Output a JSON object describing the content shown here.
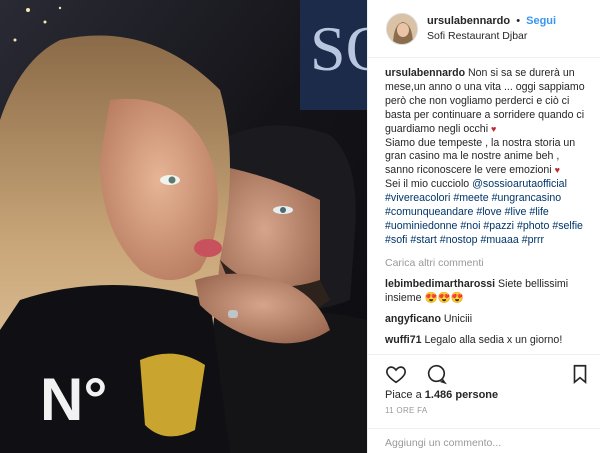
{
  "header": {
    "username": "ursulabennardo",
    "dot": "•",
    "follow_label": "Segui",
    "location": "Sofi Restaurant Djbar"
  },
  "photo": {
    "shirt_text": "N°",
    "sign_text": "SO"
  },
  "caption": {
    "username": "ursulabennardo",
    "p1": "Non si sa se durerà un mese,un anno o una vita ... oggi sappiamo però che non vogliamo perderci e ciò ci basta per continuare a sorridere quando ci guardiamo negli occhi",
    "p2": "Siamo due tempeste , la nostra storia un gran casino ma le nostre anime beh , sanno riconoscere le vere emozioni",
    "p3": "Sei il mio cucciolo",
    "mention": "@sossioarutaofficial",
    "hashtags": [
      "#vivereacolori",
      "#meete",
      "#ungrancasino",
      "#comunqueandare",
      "#love",
      "#live",
      "#life",
      "#uominiedonne",
      "#noi",
      "#pazzi",
      "#photo",
      "#selfie",
      "#sofi",
      "#start",
      "#nostop",
      "#muaaa",
      "#prrr"
    ],
    "heart": "♥"
  },
  "load_more": "Carica altri commenti",
  "comments": [
    {
      "user": "lebimbedimartharossi",
      "text": "Siete bellissimi insieme 😍😍😍"
    },
    {
      "user": "angyficano",
      "text": "Uniciii"
    },
    {
      "user": "wuffi71",
      "text": "Legalo alla sedia x un giorno!"
    },
    {
      "user": "",
      "text": ""
    }
  ],
  "actions": {
    "likes_prefix": "Piace a",
    "likes_count": "1.486 persone",
    "time": "11 ORE FA",
    "add_comment_placeholder": "Aggiungi un commento..."
  },
  "icons": [
    "heart-icon",
    "comment-icon",
    "bookmark-icon"
  ],
  "colors": {
    "link": "#003569",
    "follow": "#3897f0",
    "muted": "#999999",
    "heart": "#c0282e"
  }
}
